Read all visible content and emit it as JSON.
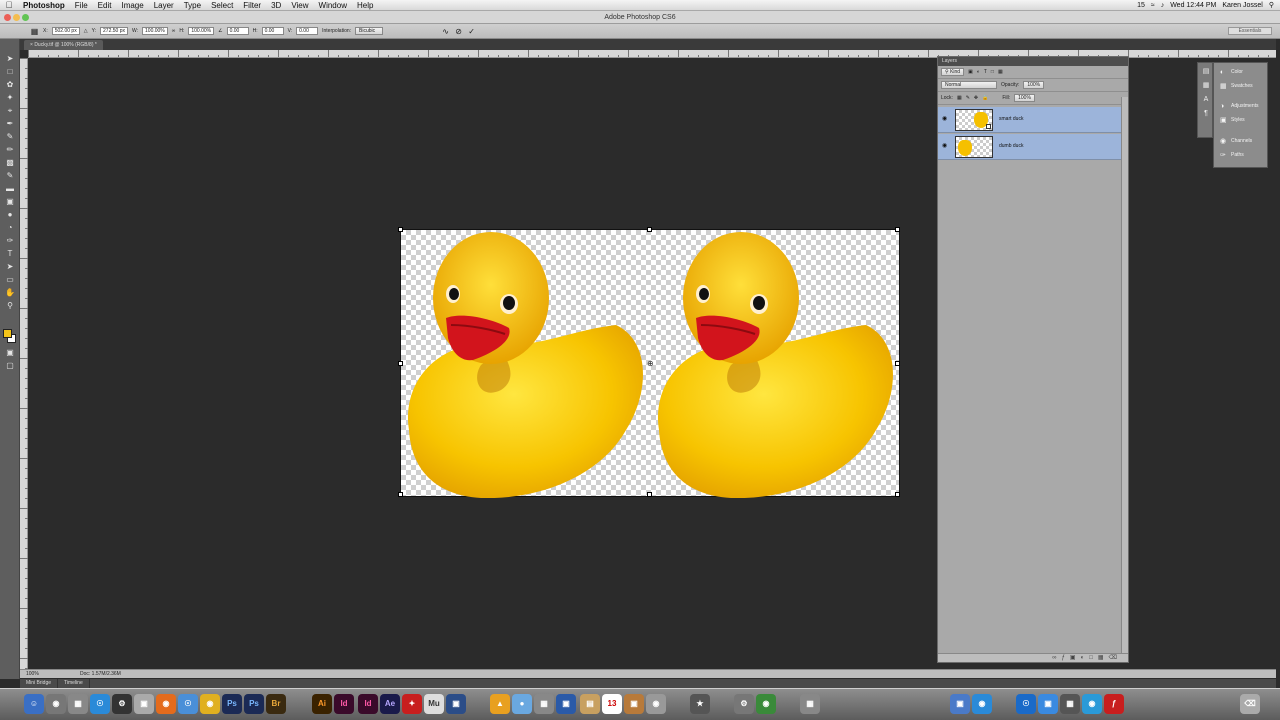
{
  "menubar": {
    "apple": "",
    "items": [
      "Photoshop",
      "File",
      "Edit",
      "Image",
      "Layer",
      "Type",
      "Select",
      "Filter",
      "3D",
      "View",
      "Window",
      "Help"
    ],
    "status_clock": "Wed 12:44 PM",
    "status_user": "Karen Jossel",
    "status_num": "15"
  },
  "window": {
    "title": "Adobe Photoshop CS6"
  },
  "options": {
    "x_value": "502.00 px",
    "y_value": "272.50 px",
    "w_value": "100.00%",
    "h_value": "100.00%",
    "angle_value": "0.00",
    "hskew_value": "0.00",
    "vskew_value": "0.00",
    "interpolation_label": "Interpolation:",
    "interpolation_value": "Bicubic",
    "workspace": "Essentials"
  },
  "document": {
    "tab_label": "Ducky.tif @ 100% (RGB/8) *"
  },
  "statusbar": {
    "zoom": "100%",
    "doc_info": "Doc: 1.57M/2.36M"
  },
  "minibar": {
    "tabs": [
      "Mini Bridge",
      "Timeline"
    ]
  },
  "layers_panel": {
    "title": "Layers",
    "kind_label": "Kind",
    "blend_mode": "Normal",
    "opacity_label": "Opacity:",
    "opacity_value": "100%",
    "lock_label": "Lock:",
    "fill_label": "Fill:",
    "fill_value": "100%",
    "layers": [
      {
        "name": "smart duck"
      },
      {
        "name": "dumb duck"
      }
    ]
  },
  "side_panels": {
    "items": [
      "Color",
      "Swatches",
      "Adjustments",
      "Styles",
      "Channels",
      "Paths"
    ]
  },
  "dock": {
    "apps": [
      "Ps",
      "Ps",
      "Br",
      "Ai",
      "Id",
      "Id",
      "Ae",
      "Mu"
    ]
  },
  "colors": {
    "foreground": "#f5c518",
    "background": "#ffffff",
    "layer_selected": "#9cb4da"
  }
}
